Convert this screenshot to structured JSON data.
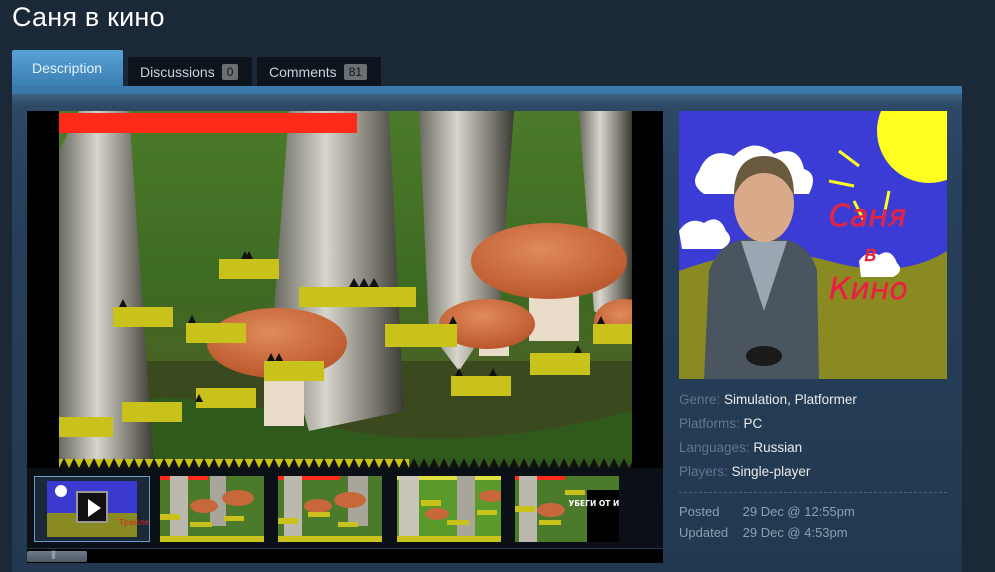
{
  "title": "Саня в кино",
  "tabs": [
    {
      "label": "Description",
      "active": true
    },
    {
      "label": "Discussions",
      "count": "0"
    },
    {
      "label": "Comments",
      "count": "81"
    }
  ],
  "capsule": {
    "text_lines": [
      "Саня",
      "в",
      "Кино"
    ]
  },
  "details": {
    "genre_label": "Genre:",
    "genre_value": "Simulation, Platformer",
    "platforms_label": "Platforms:",
    "platforms_value": "PC",
    "languages_label": "Languages:",
    "languages_value": "Russian",
    "players_label": "Players:",
    "players_value": "Single-player"
  },
  "dates": {
    "posted_label": "Posted",
    "posted_value": "29 Dec @ 12:55pm",
    "updated_label": "Updated",
    "updated_value": "29 Dec @ 4:53pm"
  },
  "thumb_text": {
    "poster_caption": "Трейлер",
    "last_thumb_text": "УБЕГИ ОТ ИЛЬИ"
  },
  "colors": {
    "background": "#1b2838",
    "tab_active": "#4a90c8",
    "panel": "#2a4560",
    "bar_red": "#ff2a1a",
    "platform_yellow": "#c8c21a"
  }
}
